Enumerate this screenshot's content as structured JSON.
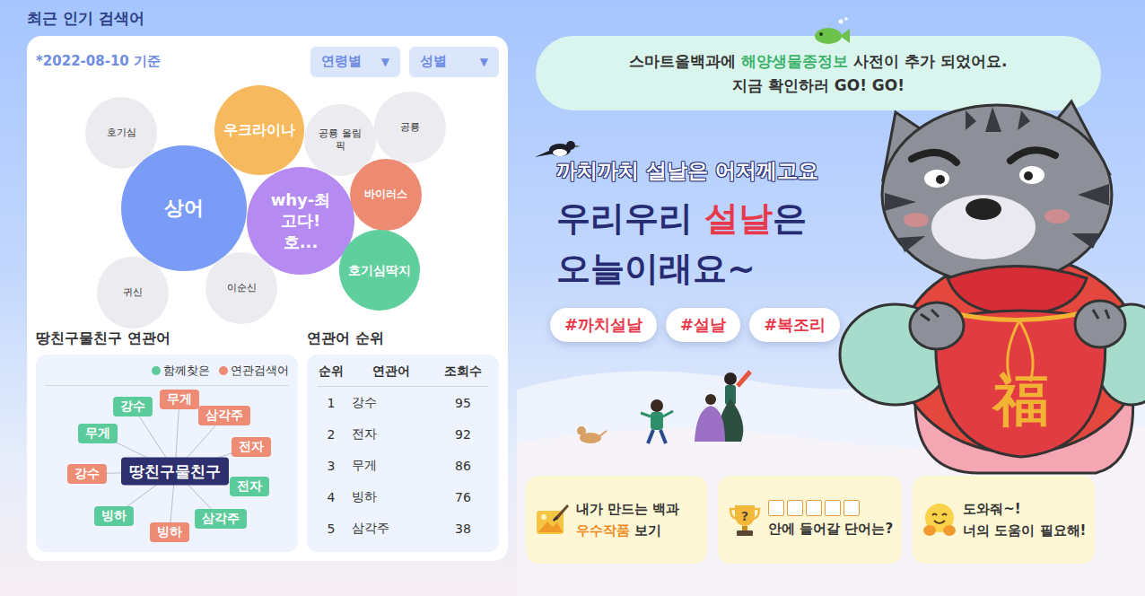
{
  "popular": {
    "title": "최근 인기 검색어",
    "date": "*2022-08-10 기준",
    "filters": [
      {
        "label": "연령별",
        "icon": "▼"
      },
      {
        "label": "성별",
        "icon": "▼"
      }
    ],
    "bubbles": [
      {
        "label": "호기심",
        "kind": "plain",
        "color": "#ebebf0"
      },
      {
        "label": "우크라이나",
        "kind": "hot",
        "color": "#f7b95d"
      },
      {
        "label": "공룡 올림픽",
        "kind": "plain",
        "color": "#ebebf0"
      },
      {
        "label": "공룡",
        "kind": "plain",
        "color": "#ebebf0"
      },
      {
        "label": "상어",
        "kind": "hot",
        "color": "#7b9cf6"
      },
      {
        "label": "why-최고다! 호...",
        "kind": "hot",
        "color": "#b68bf1"
      },
      {
        "label": "바이러스",
        "kind": "hot",
        "color": "#ec8b72"
      },
      {
        "label": "호기심딱지",
        "kind": "hot",
        "color": "#5fcf9e"
      },
      {
        "label": "귀신",
        "kind": "plain",
        "color": "#ebebf0"
      },
      {
        "label": "이순신",
        "kind": "plain",
        "color": "#ebebf0"
      }
    ]
  },
  "related": {
    "title": "땅친구물친구 연관어",
    "legend": [
      {
        "label": "함께찾은",
        "color": "#5ccb9b"
      },
      {
        "label": "연관검색어",
        "color": "#ee8b74"
      }
    ],
    "center": "땅친구물친구",
    "nodes": [
      {
        "label": "강수",
        "color": "#5ccb9b"
      },
      {
        "label": "무게",
        "color": "#ee8b74"
      },
      {
        "label": "삼각주",
        "color": "#ee8b74"
      },
      {
        "label": "무게",
        "color": "#5ccb9b"
      },
      {
        "label": "전자",
        "color": "#ee8b74"
      },
      {
        "label": "강수",
        "color": "#ee8b74"
      },
      {
        "label": "전자",
        "color": "#5ccb9b"
      },
      {
        "label": "빙하",
        "color": "#5ccb9b"
      },
      {
        "label": "삼각주",
        "color": "#5ccb9b"
      },
      {
        "label": "빙하",
        "color": "#ee8b74"
      }
    ]
  },
  "ranking": {
    "title": "연관어 순위",
    "columns": [
      "순위",
      "연관어",
      "조회수"
    ],
    "rows": [
      {
        "rank": "1",
        "word": "강수",
        "views": "95"
      },
      {
        "rank": "2",
        "word": "전자",
        "views": "92"
      },
      {
        "rank": "3",
        "word": "무게",
        "views": "86"
      },
      {
        "rank": "4",
        "word": "빙하",
        "views": "76"
      },
      {
        "rank": "5",
        "word": "삼각주",
        "views": "38"
      }
    ]
  },
  "notice": {
    "lines": [
      [
        {
          "text": "스마트올백과에 ",
          "highlight": false
        },
        {
          "text": "해양생물종정보",
          "highlight": true
        },
        {
          "text": " 사전이 추가 되었어요.",
          "highlight": false
        }
      ],
      [
        {
          "text": "지금 확인하러 GO! GO!",
          "highlight": false
        }
      ]
    ]
  },
  "banner": {
    "subtitle": "까치까치 설날은 어저께고요",
    "title_lines": [
      [
        {
          "text": "우리우리 ",
          "highlight": false
        },
        {
          "text": "설날",
          "highlight": true
        },
        {
          "text": "은",
          "highlight": false
        }
      ],
      [
        {
          "text": "오늘이래요~",
          "highlight": false
        }
      ]
    ],
    "hashtags": [
      "#까치설날",
      "#설날",
      "#복조리"
    ],
    "bag_char": "福"
  },
  "cards": [
    {
      "kind": "gallery",
      "blanks": 0,
      "icon_text": "",
      "lines": [
        [
          {
            "text": "내가 만드는 백과",
            "highlight": false
          }
        ],
        [
          {
            "text": "우수작품",
            "highlight": true
          },
          {
            "text": " 보기",
            "highlight": false
          }
        ]
      ]
    },
    {
      "kind": "quiz",
      "blanks": 5,
      "icon_text": "?",
      "lines": [
        [
          {
            "text": "안에 들어갈 단어는?",
            "highlight": false
          }
        ]
      ]
    },
    {
      "kind": "help",
      "blanks": 0,
      "icon_text": "",
      "lines": [
        [
          {
            "text": "도와줘~!",
            "highlight": false
          }
        ],
        [
          {
            "text": "너의 도움이 필요해!",
            "highlight": false
          }
        ]
      ]
    }
  ]
}
